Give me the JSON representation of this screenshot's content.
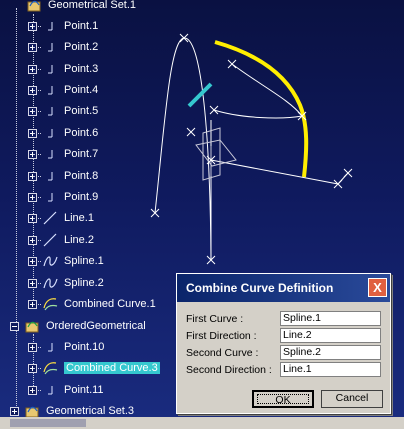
{
  "tree": {
    "items": [
      {
        "label": "Geometrical Set.1",
        "icon": "geometrical-set-icon"
      },
      {
        "label": "Point.1",
        "icon": "point-icon"
      },
      {
        "label": "Point.2",
        "icon": "point-icon"
      },
      {
        "label": "Point.3",
        "icon": "point-icon"
      },
      {
        "label": "Point.4",
        "icon": "point-icon"
      },
      {
        "label": "Point.5",
        "icon": "point-icon"
      },
      {
        "label": "Point.6",
        "icon": "point-icon"
      },
      {
        "label": "Point.7",
        "icon": "point-icon"
      },
      {
        "label": "Point.8",
        "icon": "point-icon"
      },
      {
        "label": "Point.9",
        "icon": "point-icon"
      },
      {
        "label": "Line.1",
        "icon": "line-icon"
      },
      {
        "label": "Line.2",
        "icon": "line-icon"
      },
      {
        "label": "Spline.1",
        "icon": "spline-icon"
      },
      {
        "label": "Spline.2",
        "icon": "spline-icon"
      },
      {
        "label": "Combined Curve.1",
        "icon": "combined-curve-icon"
      },
      {
        "label": "OrderedGeometrical",
        "icon": "ordered-geometrical-set-icon"
      },
      {
        "label": "Point.10",
        "icon": "point-icon"
      },
      {
        "label": "Combined Curve.3",
        "icon": "combined-curve-icon",
        "selected": true
      },
      {
        "label": "Point.11",
        "icon": "point-icon"
      },
      {
        "label": "Geometrical Set.3",
        "icon": "geometrical-set-icon"
      }
    ]
  },
  "dialog": {
    "title": "Combine Curve Definition",
    "close_label": "X",
    "fields": [
      {
        "label": "First Curve :",
        "value": "Spline.1"
      },
      {
        "label": "First Direction :",
        "value": "Line.2"
      },
      {
        "label": "Second Curve :",
        "value": "Spline.2"
      },
      {
        "label": "Second Direction :",
        "value": "Line.1"
      }
    ],
    "ok_label": "OK",
    "cancel_label": "Cancel"
  },
  "colors": {
    "background": "#0f1a5e",
    "selection": "#35c8cf",
    "highlight_curve": "#ffee00",
    "dialog_title": "#0a246a"
  }
}
